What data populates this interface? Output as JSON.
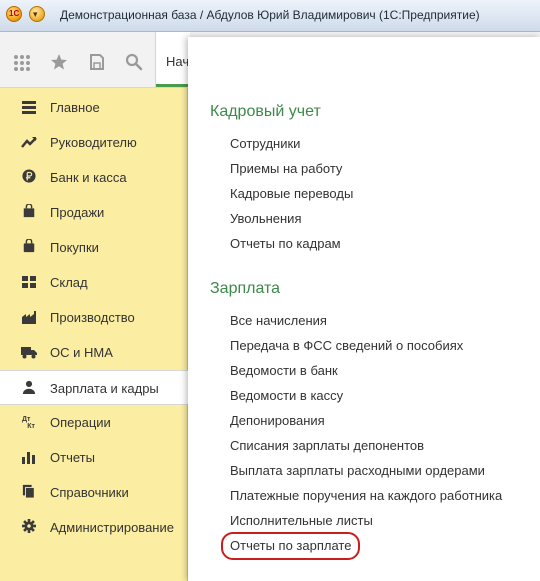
{
  "window": {
    "title": "Демонстрационная база / Абдулов Юрий Владимирович  (1С:Предприятие)"
  },
  "toolbar": {
    "start_tab_label": "Нача"
  },
  "sidebar": {
    "items": [
      {
        "label": "Главное",
        "icon": "list-icon"
      },
      {
        "label": "Руководителю",
        "icon": "trend-icon"
      },
      {
        "label": "Банк и касса",
        "icon": "ruble-icon"
      },
      {
        "label": "Продажи",
        "icon": "bag-icon"
      },
      {
        "label": "Покупки",
        "icon": "cart-icon"
      },
      {
        "label": "Склад",
        "icon": "warehouse-icon"
      },
      {
        "label": "Производство",
        "icon": "factory-icon"
      },
      {
        "label": "ОС и НМА",
        "icon": "truck-icon"
      },
      {
        "label": "Зарплата и кадры",
        "icon": "person-icon",
        "active": true
      },
      {
        "label": "Операции",
        "icon": "operations-icon"
      },
      {
        "label": "Отчеты",
        "icon": "bar-chart-icon"
      },
      {
        "label": "Справочники",
        "icon": "books-icon"
      },
      {
        "label": "Администрирование",
        "icon": "gear-icon"
      }
    ]
  },
  "panel": {
    "hr_section": {
      "title": "Кадровый учет",
      "links": [
        "Сотрудники",
        "Приемы на работу",
        "Кадровые переводы",
        "Увольнения",
        "Отчеты по кадрам"
      ]
    },
    "salary_section": {
      "title": "Зарплата",
      "links": [
        "Все начисления",
        "Передача в ФСС сведений о пособиях",
        "Ведомости в банк",
        "Ведомости в кассу",
        "Депонирования",
        "Списания зарплаты депонентов",
        "Выплата зарплаты расходными ордерами",
        "Платежные поручения на каждого работника",
        "Исполнительные листы",
        "Отчеты по зарплате"
      ]
    }
  },
  "colors": {
    "sidebar_bg": "#fbeea2",
    "section_title": "#3c8a4a",
    "highlight_circle": "#c81e1e"
  }
}
